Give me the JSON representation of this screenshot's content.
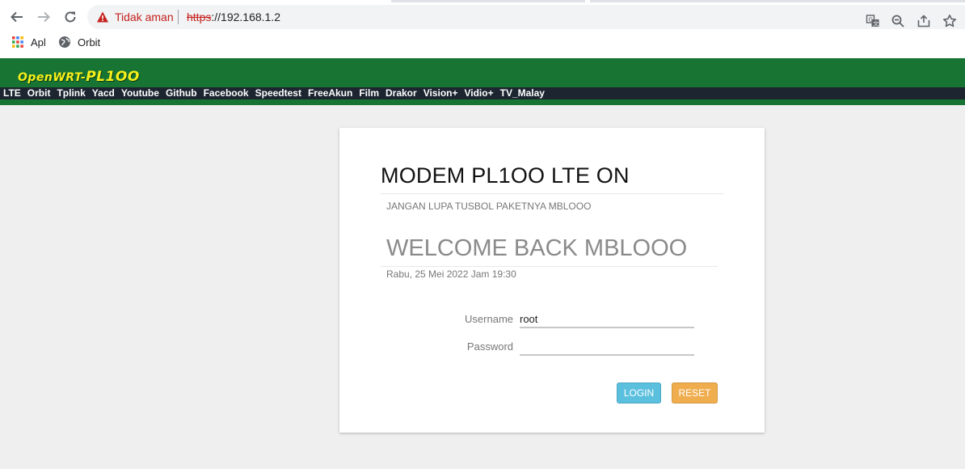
{
  "browser": {
    "not_secure_label": "Tidak aman",
    "url_scheme": "https",
    "url_rest": "://192.168.1.2",
    "bookmarks": [
      {
        "label": "Apl",
        "icon": "apps-grid-icon"
      },
      {
        "label": "Orbit",
        "icon": "globe-icon"
      }
    ]
  },
  "router": {
    "logo_prefix": "OpenWRT-",
    "logo_main": "PL1OO",
    "menu": [
      "LTE",
      "Orbit",
      "Tplink",
      "Yacd",
      "Youtube",
      "Github",
      "Facebook",
      "Speedtest",
      "FreeAkun",
      "Film",
      "Drakor",
      "Vision+",
      "Vidio+",
      "TV_Malay"
    ],
    "colors": {
      "header": "#187433",
      "menubar": "#1c2530",
      "logo": "#f7f01b"
    }
  },
  "login": {
    "title": "MODEM PL1OO LTE ON",
    "subtitle": "JANGAN LUPA TUSBOL PAKETNYA MBLOOO",
    "welcome": "WELCOME BACK MBLOOO",
    "datetime": "Rabu, 25 Mei 2022 Jam 19:30",
    "username_label": "Username",
    "username_value": "root",
    "password_label": "Password",
    "password_value": "",
    "login_button": "LOGIN",
    "reset_button": "RESET"
  }
}
